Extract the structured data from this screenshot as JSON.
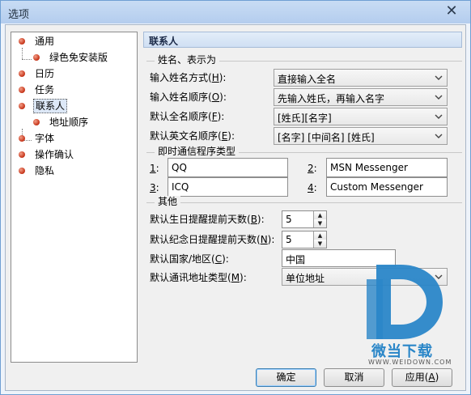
{
  "window": {
    "title": "选项",
    "close_glyph": "✕"
  },
  "tree": {
    "items": [
      {
        "label": "通用",
        "icon": "bullet-icon"
      },
      {
        "label": "绿色免安装版",
        "icon": "bullet-icon"
      },
      {
        "label": "日历",
        "icon": "bullet-icon"
      },
      {
        "label": "任务",
        "icon": "bullet-icon"
      },
      {
        "label": "联系人",
        "icon": "bullet-icon",
        "selected": true
      },
      {
        "label": "地址顺序",
        "icon": "bullet-icon"
      },
      {
        "label": "字体",
        "icon": "bullet-icon"
      },
      {
        "label": "操作确认",
        "icon": "bullet-icon"
      },
      {
        "label": "隐私",
        "icon": "bullet-icon"
      }
    ]
  },
  "panel": {
    "title": "联系人"
  },
  "name_group": {
    "title": "姓名、表示为",
    "rows": [
      {
        "label_pre": "输入姓名方式(",
        "key": "H",
        "label_post": "):",
        "value": "直接输入全名",
        "style": "gray"
      },
      {
        "label_pre": "输入姓名顺序(",
        "key": "O",
        "label_post": "):",
        "value": "先输入姓氏，再输入名字",
        "style": "gray"
      },
      {
        "label_pre": "默认全名顺序(",
        "key": "F",
        "label_post": "):",
        "value": "[姓氏][名字]",
        "style": "gray"
      },
      {
        "label_pre": "默认英文名顺序(",
        "key": "E",
        "label_post": "):",
        "value": "[名字] [中间名] [姓氏]",
        "style": "gray"
      }
    ]
  },
  "im_group": {
    "title": "即时通信程序类型",
    "items": [
      {
        "num": "1",
        "suffix": ":",
        "value": "QQ"
      },
      {
        "num": "2",
        "suffix": ":",
        "value": "MSN Messenger"
      },
      {
        "num": "3",
        "suffix": ":",
        "value": "ICQ"
      },
      {
        "num": "4",
        "suffix": ":",
        "value": "Custom Messenger"
      }
    ]
  },
  "other_group": {
    "title": "其他",
    "birthday": {
      "label_pre": "默认生日提醒提前天数(",
      "key": "B",
      "label_post": "):",
      "value": "5"
    },
    "anniversary": {
      "label_pre": "默认纪念日提醒提前天数(",
      "key": "N",
      "label_post": "):",
      "value": "5"
    },
    "country": {
      "label_pre": "默认国家/地区(",
      "key": "C",
      "label_post": "):",
      "value": "中国"
    },
    "address_type": {
      "label_pre": "默认通讯地址类型(",
      "key": "M",
      "label_post": "):",
      "value": "单位地址"
    }
  },
  "buttons": {
    "ok": "确定",
    "cancel": "取消",
    "apply_pre": "应用(",
    "apply_key": "A",
    "apply_post": ")"
  },
  "watermark": {
    "brand": "微当下载",
    "url": "WWW.WEIDOWN.COM",
    "color": "#2a86c8"
  }
}
